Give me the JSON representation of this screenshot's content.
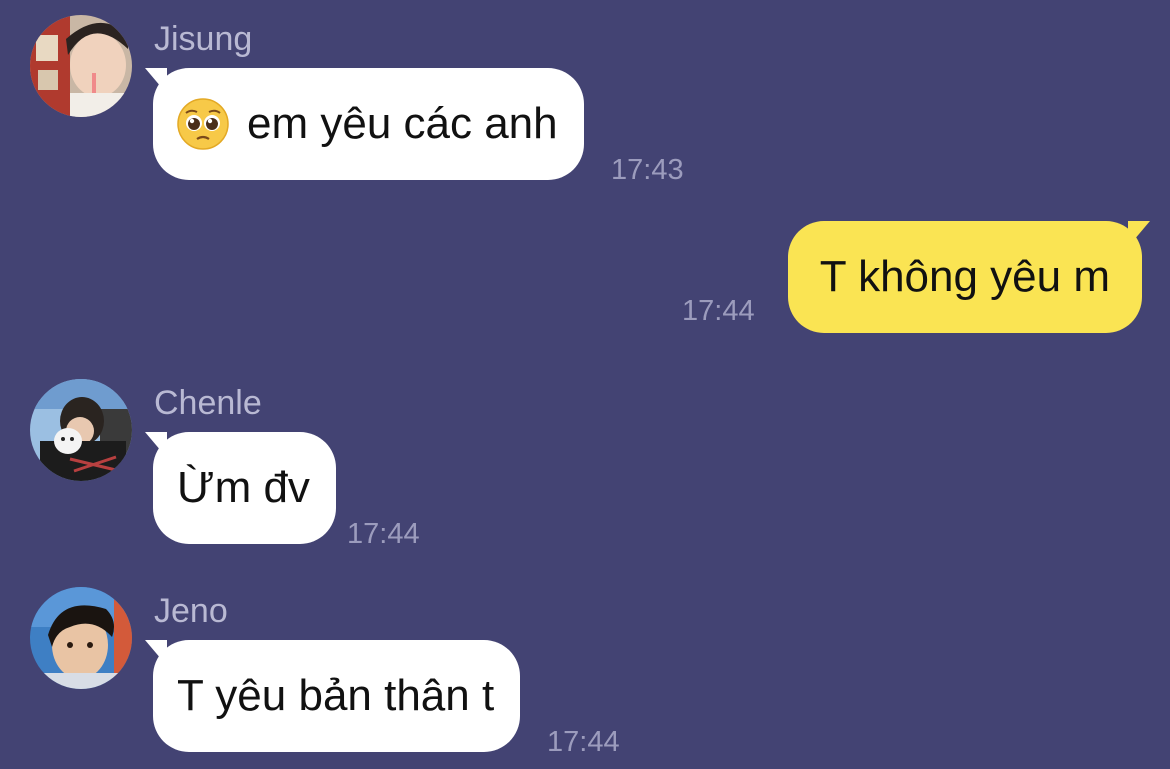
{
  "messages": [
    {
      "sender": "Jisung",
      "text": "em yêu các anh",
      "time": "17:43",
      "emoji": "pleading-face-icon"
    },
    {
      "text": "T không yêu m",
      "time": "17:44"
    },
    {
      "sender": "Chenle",
      "text": "Ừm đv",
      "time": "17:44"
    },
    {
      "sender": "Jeno",
      "text": "T yêu bản thân t",
      "time": "17:44"
    }
  ],
  "colors": {
    "background": "#434373",
    "incoming_bubble": "#ffffff",
    "outgoing_bubble": "#fae453",
    "sender_name": "#b9b9d3",
    "timestamp": "#9c9cbd"
  }
}
